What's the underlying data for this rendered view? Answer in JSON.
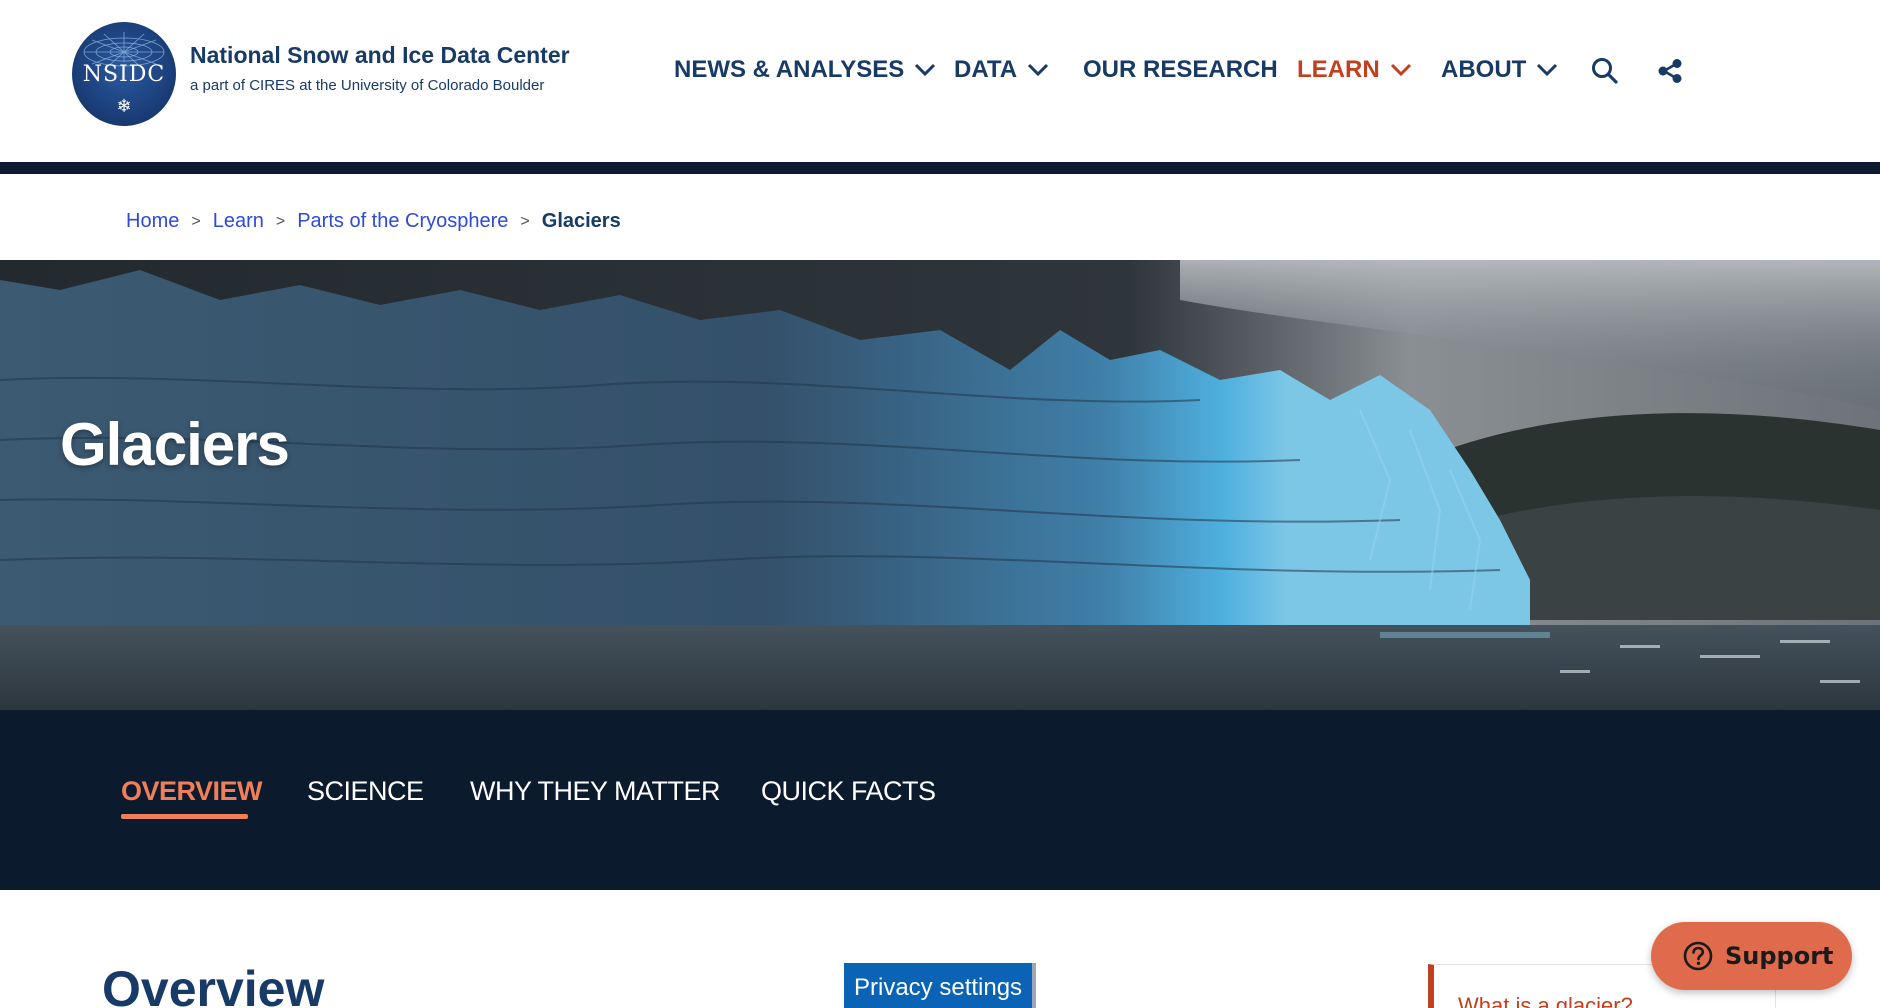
{
  "header": {
    "logo_text": "NSIDC",
    "org_name": "National Snow and Ice Data Center",
    "org_subtitle": "a part of CIRES at the University of Colorado Boulder",
    "nav": [
      {
        "label": "NEWS & ANALYSES",
        "has_dropdown": true,
        "active": false
      },
      {
        "label": "DATA",
        "has_dropdown": true,
        "active": false
      },
      {
        "label": "OUR RESEARCH",
        "has_dropdown": false,
        "active": false
      },
      {
        "label": "LEARN",
        "has_dropdown": true,
        "active": true
      },
      {
        "label": "ABOUT",
        "has_dropdown": true,
        "active": false
      }
    ],
    "icons": [
      "search-icon",
      "share-icon"
    ]
  },
  "breadcrumb": {
    "items": [
      "Home",
      "Learn",
      "Parts of the Cryosphere"
    ],
    "current": "Glaciers",
    "separator": ">"
  },
  "hero": {
    "title": "Glaciers"
  },
  "tabs": [
    {
      "label": "OVERVIEW",
      "active": true
    },
    {
      "label": "SCIENCE",
      "active": false
    },
    {
      "label": "WHY THEY MATTER",
      "active": false
    },
    {
      "label": "QUICK FACTS",
      "active": false
    }
  ],
  "content": {
    "heading": "Overview",
    "toc_first_item": "What is a glacier?"
  },
  "privacy_button": "Privacy settings",
  "support_button": "Support",
  "colors": {
    "navy": "#173a66",
    "accent_red": "#c2401f",
    "tab_active": "#f07f57",
    "tabbar_bg": "#0c1a2e",
    "link_blue": "#2e4ad9",
    "privacy_blue": "#0a63b5",
    "support_bg": "#e06a4c"
  }
}
